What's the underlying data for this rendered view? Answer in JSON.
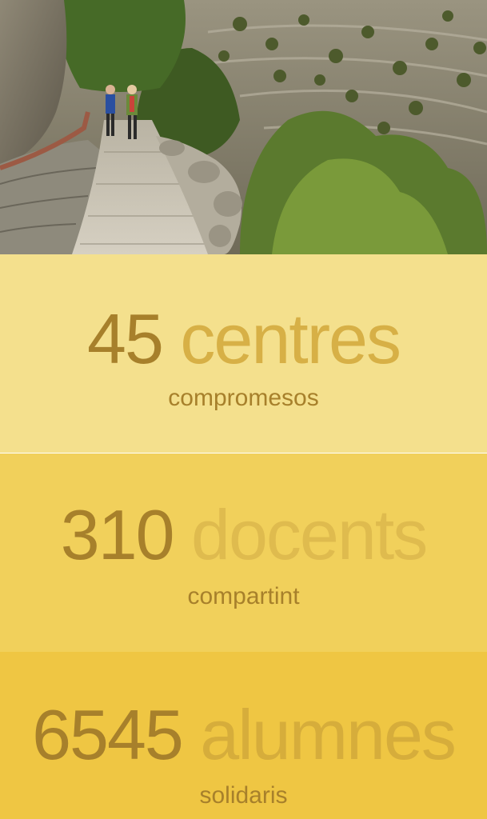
{
  "hero": {
    "image_description_icon": "photo-hikers-stone-path"
  },
  "colors": {
    "band_1": "#f4e08d",
    "band_2": "#f1d05b",
    "band_3": "#efc643",
    "number_color": "#a7802b",
    "unit_color": "#d7b046"
  },
  "stats": [
    {
      "number": "45",
      "unit": "centres",
      "caption": "compromesos"
    },
    {
      "number": "310",
      "unit": "docents",
      "caption": "compartint"
    },
    {
      "number": "6545",
      "unit": "alumnes",
      "caption": "solidaris"
    }
  ]
}
